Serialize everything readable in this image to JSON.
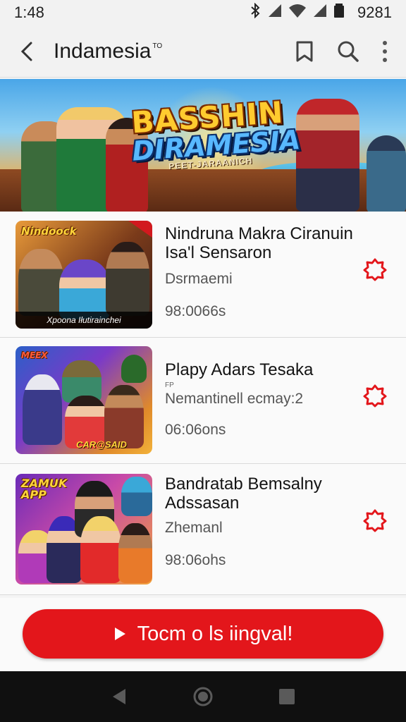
{
  "status": {
    "time": "1:48",
    "battery": "9281",
    "icons": [
      "bluetooth-icon",
      "signal-icon",
      "wifi-icon",
      "signal-icon",
      "battery-icon"
    ]
  },
  "app_bar": {
    "title": "Indamesia",
    "title_mark": "TO",
    "actions": [
      "bookmark-icon",
      "search-icon",
      "more-vert-icon"
    ]
  },
  "banner": {
    "line1": "BASSHIN",
    "line2": "DIRAMESIA",
    "line3": "PEET-JARAANICH",
    "dots": 4,
    "active_dot": 0
  },
  "items": [
    {
      "title": "Nindruna Makra Ciranuin Isa'l Sensaron",
      "subtitle": "Dsrmaemi",
      "count": "98:0066s",
      "thumb_tag": "Nindoock",
      "thumb_caption": "Xpoona Iłutirainchei"
    },
    {
      "title": "Plapy Adars Tesaka",
      "subtitle": "Nemantinell ecmay:2",
      "subtitle_prefix": "FP",
      "count": "06:06ons",
      "thumb_tag": "MEEX",
      "thumb_caption": "CAR@SAID"
    },
    {
      "title": "Bandratab Bemsalny Adssasan",
      "subtitle": "Zhemanl",
      "count": "98:06ohs",
      "thumb_tag": "ZAMUK APP",
      "thumb_caption": ""
    }
  ],
  "cta": {
    "label": "Tocm o ls iingval!",
    "icon": "play-icon"
  },
  "nav": [
    "back-nav-icon",
    "home-nav-icon",
    "recents-nav-icon"
  ],
  "colors": {
    "accent": "#e3161b",
    "background": "#f4f4f4",
    "navbar": "#101010"
  }
}
